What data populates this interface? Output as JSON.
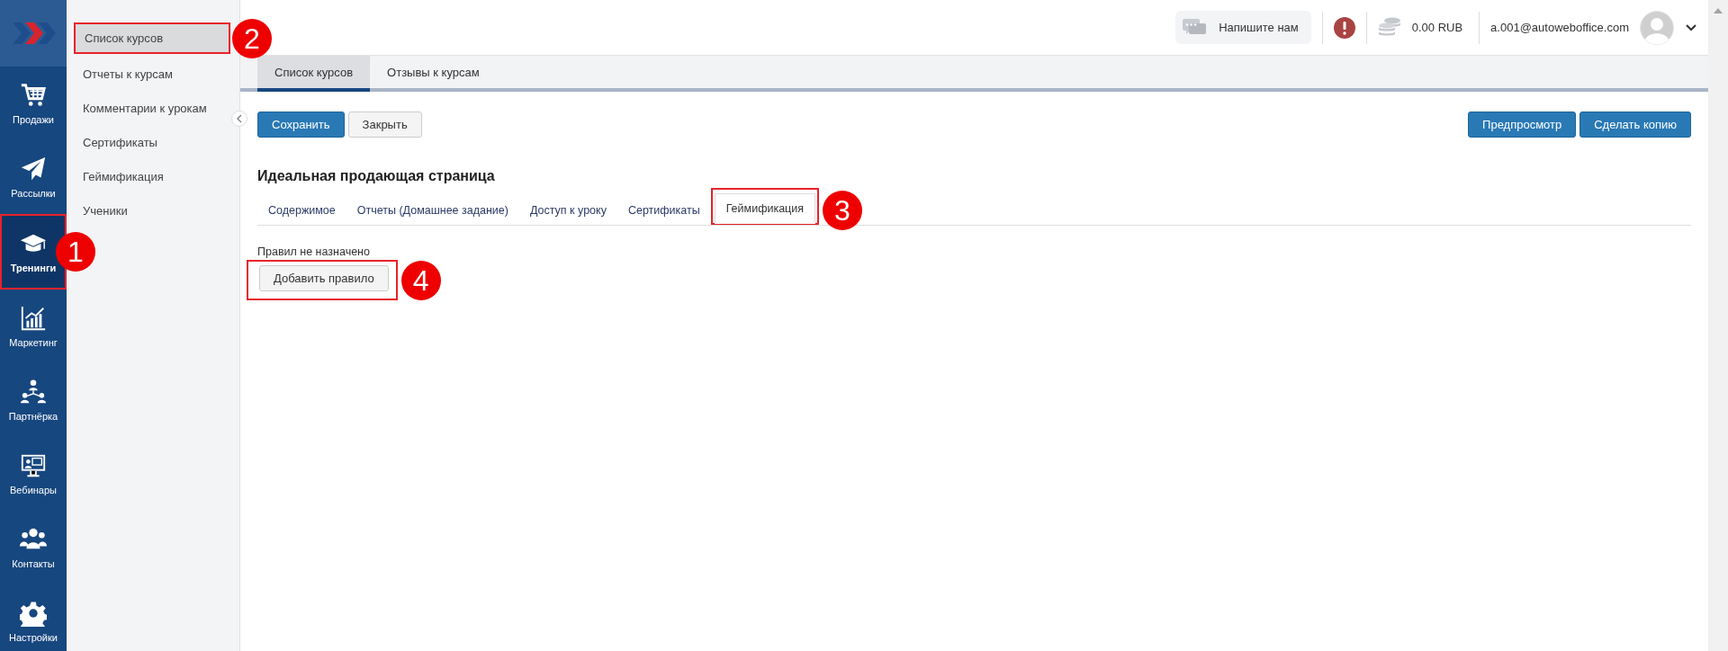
{
  "nav": [
    {
      "label": "Продажи",
      "kind": "cart",
      "selected": false
    },
    {
      "label": "Рассылки",
      "kind": "plane",
      "selected": false
    },
    {
      "label": "Тренинги",
      "kind": "cap",
      "selected": true,
      "callout": "1"
    },
    {
      "label": "Маркетинг",
      "kind": "chart",
      "selected": false
    },
    {
      "label": "Партнёрка",
      "kind": "org",
      "selected": false
    },
    {
      "label": "Вебинары",
      "kind": "monitor",
      "selected": false
    },
    {
      "label": "Контакты",
      "kind": "people",
      "selected": false
    },
    {
      "label": "Настройки",
      "kind": "gear",
      "selected": false
    }
  ],
  "submenu": [
    {
      "label": "Список курсов",
      "selected": true,
      "callout": "2"
    },
    {
      "label": "Отчеты к курсам",
      "selected": false
    },
    {
      "label": "Комментарии к урокам",
      "selected": false
    },
    {
      "label": "Сертификаты",
      "selected": false
    },
    {
      "label": "Геймификация",
      "selected": false
    },
    {
      "label": "Ученики",
      "selected": false
    }
  ],
  "topbar": {
    "chat_button": "Напишите нам",
    "balance": "0.00 RUB",
    "email": "a.001@autoweboffice.com"
  },
  "page_tabs": [
    {
      "label": "Список курсов",
      "selected": true
    },
    {
      "label": "Отзывы к курсам",
      "selected": false
    }
  ],
  "toolbar": {
    "left": [
      {
        "label": "Сохранить",
        "kind": "primary"
      },
      {
        "label": "Закрыть",
        "kind": "default"
      }
    ],
    "right": [
      {
        "label": "Предпросмотр",
        "kind": "primary"
      },
      {
        "label": "Сделать копию",
        "kind": "primary"
      }
    ]
  },
  "title": "Идеальная продающая страница",
  "content_tabs": [
    {
      "label": "Содержимое",
      "selected": false
    },
    {
      "label": "Отчеты (Домашнее задание)",
      "selected": false
    },
    {
      "label": "Доступ к уроку",
      "selected": false
    },
    {
      "label": "Сертификаты",
      "selected": false
    },
    {
      "label": "Геймификация",
      "selected": true,
      "callout": "3"
    }
  ],
  "rules": {
    "empty_text": "Правил не назначено",
    "add_button": "Добавить правило",
    "callout": "4"
  }
}
